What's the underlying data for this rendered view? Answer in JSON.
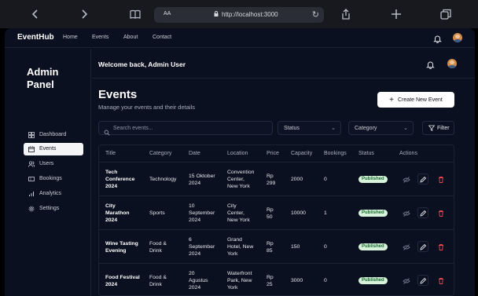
{
  "browser": {
    "aa_label": "AA",
    "url": "http://localhost:3000"
  },
  "topnav": {
    "logo": "EventHub",
    "links": [
      "Home",
      "Events",
      "About",
      "Contact"
    ]
  },
  "sidebar": {
    "title": "Admin Panel",
    "items": [
      {
        "label": "Dashboard",
        "icon": "dashboard-icon",
        "active": false
      },
      {
        "label": "Events",
        "icon": "calendar-icon",
        "active": true
      },
      {
        "label": "Users",
        "icon": "users-icon",
        "active": false
      },
      {
        "label": "Bookings",
        "icon": "ticket-icon",
        "active": false
      },
      {
        "label": "Analytics",
        "icon": "chart-icon",
        "active": false
      },
      {
        "label": "Settings",
        "icon": "gear-icon",
        "active": false
      }
    ]
  },
  "header": {
    "welcome": "Welcome back, Admin User"
  },
  "page": {
    "title": "Events",
    "subtitle": "Manage your events and their details",
    "create_label": "Create New Event"
  },
  "filters": {
    "search_placeholder": "Search events...",
    "status_label": "Status",
    "category_label": "Category",
    "filter_label": "Filter"
  },
  "table": {
    "columns": [
      "Title",
      "Category",
      "Date",
      "Location",
      "Price",
      "Capacity",
      "Bookings",
      "Status",
      "Actions"
    ],
    "rows": [
      {
        "title": [
          "Tech",
          "Conference",
          "2024"
        ],
        "category": [
          "Technology"
        ],
        "date": [
          "15 Oktober",
          "2024"
        ],
        "location": [
          "Convention",
          "Center,",
          "New York"
        ],
        "price": [
          "Rp",
          "299"
        ],
        "capacity": "2000",
        "bookings": "0",
        "status": "Published"
      },
      {
        "title": [
          "City",
          "Marathon",
          "2024"
        ],
        "category": [
          "Sports"
        ],
        "date": [
          "10",
          "September",
          "2024"
        ],
        "location": [
          "City",
          "Center,",
          "New York"
        ],
        "price": [
          "Rp",
          "50"
        ],
        "capacity": "10000",
        "bookings": "1",
        "status": "Published"
      },
      {
        "title": [
          "Wine Tasting",
          "Evening"
        ],
        "category": [
          "Food &",
          "Drink"
        ],
        "date": [
          "6",
          "September",
          "2024"
        ],
        "location": [
          "Grand",
          "Hotel, New",
          "York"
        ],
        "price": [
          "Rp",
          "85"
        ],
        "capacity": "150",
        "bookings": "0",
        "status": "Published"
      },
      {
        "title": [
          "Food Festival",
          "2024"
        ],
        "category": [
          "Food &",
          "Drink"
        ],
        "date": [
          "20",
          "Agustus",
          "2024"
        ],
        "location": [
          "Waterfront",
          "Park, New",
          "York"
        ],
        "price": [
          "Rp",
          "25"
        ],
        "capacity": "3000",
        "bookings": "0",
        "status": "Published"
      }
    ]
  },
  "colors": {
    "background": "#0b1020",
    "badge_bg": "#d8f3dc",
    "badge_text": "#1a6b31",
    "delete": "#e5484d"
  }
}
